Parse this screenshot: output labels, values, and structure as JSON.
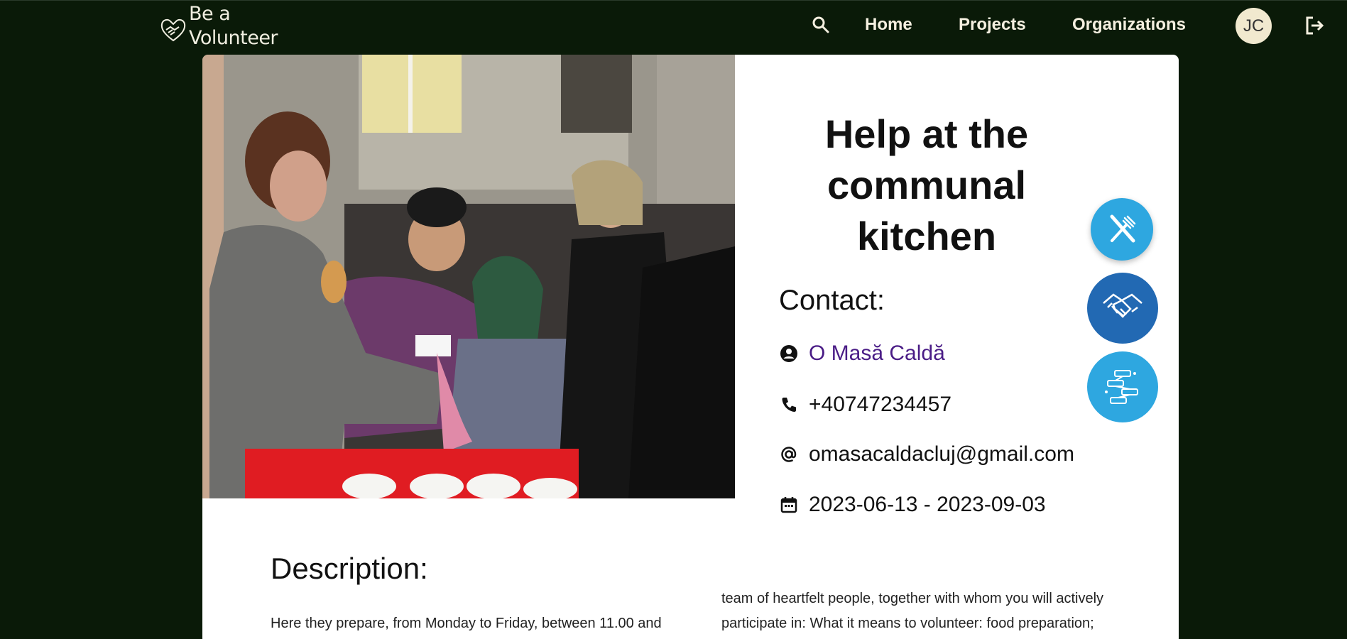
{
  "app": {
    "brand_line1": "Be a",
    "brand_line2": "Volunteer"
  },
  "nav": {
    "home": "Home",
    "projects": "Projects",
    "organizations": "Organizations",
    "avatar_initials": "JC"
  },
  "icons": {
    "brand": "heart-handshake-icon",
    "search": "search-icon",
    "logout": "logout-icon",
    "org": "account-circle-icon",
    "phone": "phone-icon",
    "email": "at-sign-icon",
    "date": "calendar-icon",
    "category1": "fork-knife-icon",
    "category2": "handshake-icon",
    "category3": "chat-network-icon"
  },
  "project": {
    "title": "Help at the communal kitchen",
    "contact_heading": "Contact:",
    "organization": "O Masă Caldă",
    "phone": "+40747234457",
    "email": "omasacaldacluj@gmail.com",
    "dates": "2023-06-13 - 2023-09-03",
    "description_heading": "Description:",
    "description_left": "Here they prepare, from Monday to Friday, between 11.00 and",
    "description_right": "team of heartfelt people, together with whom you will actively participate in: What it means to volunteer: food preparation;"
  },
  "colors": {
    "background": "#0a1a08",
    "card": "#ffffff",
    "link": "#4a1c86",
    "category_light": "#2ea7e0",
    "category_dark": "#2269b3",
    "avatar": "#f1e9cf"
  }
}
